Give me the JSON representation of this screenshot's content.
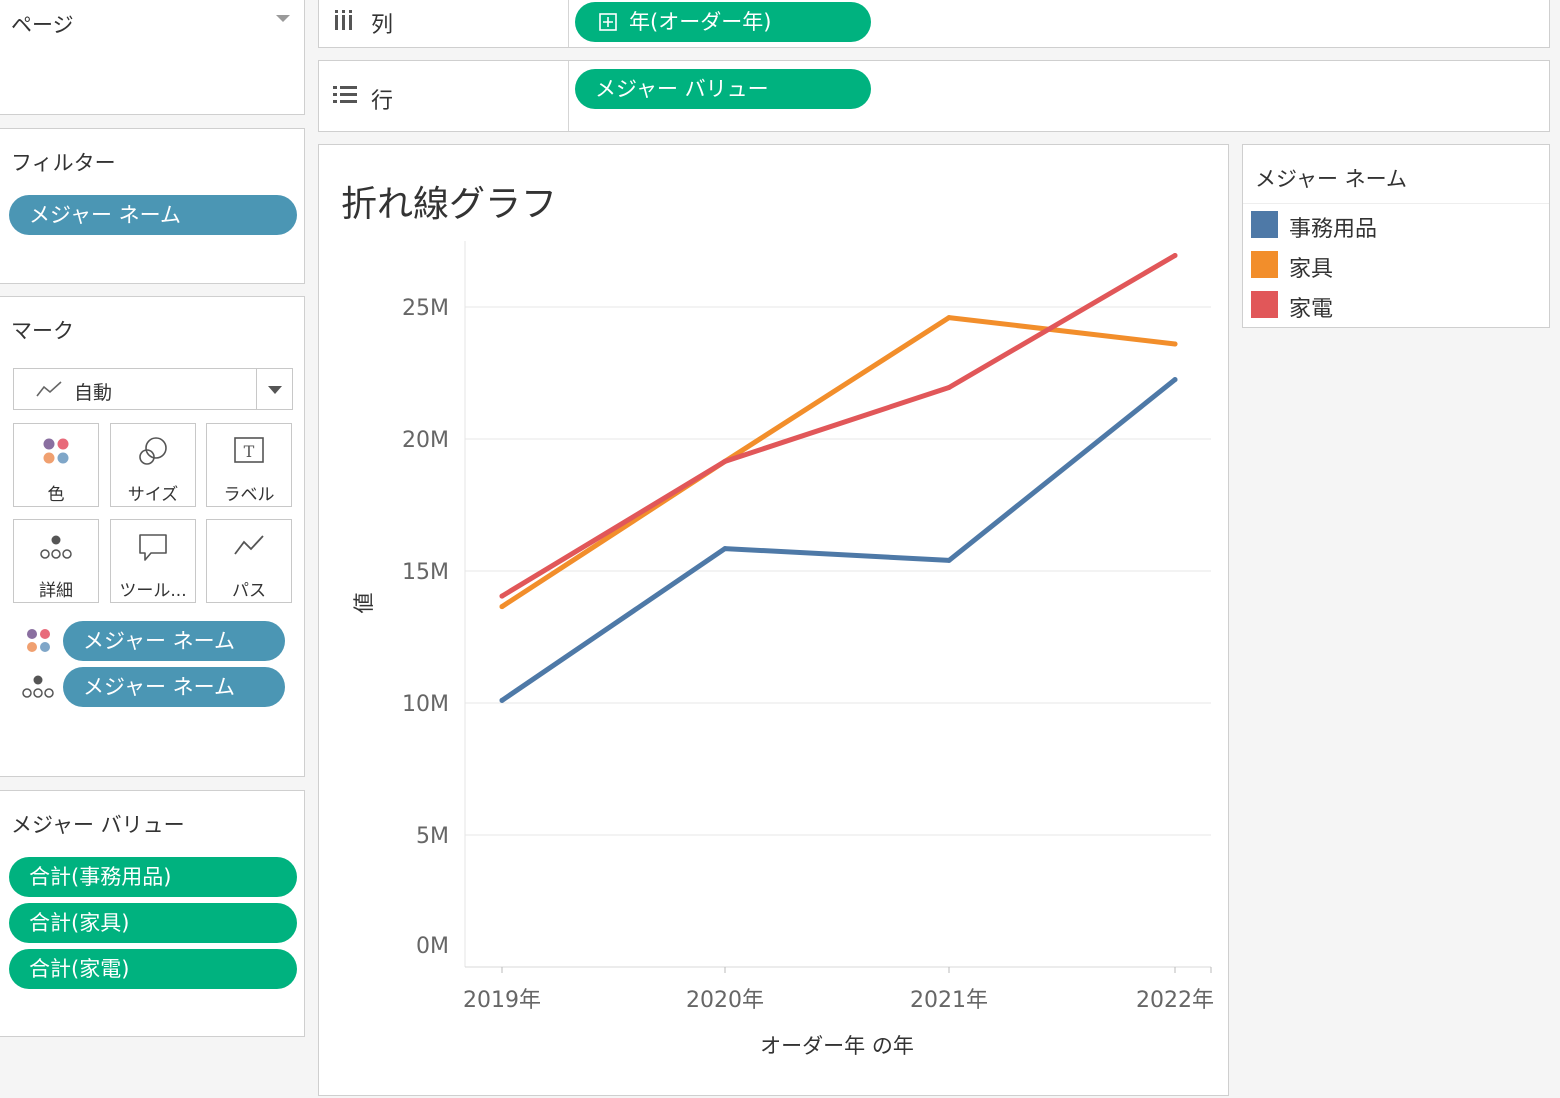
{
  "sidebar": {
    "pages": {
      "title": "ページ"
    },
    "filters": {
      "title": "フィルター",
      "pills": [
        "メジャー ネーム"
      ]
    },
    "marks": {
      "title": "マーク",
      "mark_type": "自動",
      "cards": {
        "color": "色",
        "size": "サイズ",
        "label": "ラベル",
        "detail": "詳細",
        "tooltip": "ツール...",
        "path": "パス"
      },
      "shelf_pills": {
        "color": "メジャー ネーム",
        "detail": "メジャー ネーム"
      }
    },
    "measure_values": {
      "title": "メジャー バリュー",
      "pills": [
        "合計(事務用品)",
        "合計(家具)",
        "合計(家電)"
      ]
    }
  },
  "shelves": {
    "columns": {
      "label": "列",
      "pill": "年(オーダー年)"
    },
    "rows": {
      "label": "行",
      "pill": "メジャー バリュー"
    }
  },
  "legend": {
    "title": "メジャー ネーム",
    "items": [
      {
        "label": "事務用品",
        "color": "#4e79a7"
      },
      {
        "label": "家具",
        "color": "#f28e2b"
      },
      {
        "label": "家電",
        "color": "#e15759"
      }
    ]
  },
  "chart_data": {
    "type": "line",
    "title": "折れ線グラフ",
    "xlabel": "オーダー年 の年",
    "ylabel": "値",
    "categories": [
      "2019年",
      "2020年",
      "2021年",
      "2022年"
    ],
    "ylim": [
      0,
      27500000
    ],
    "yticks": [
      0,
      5000000,
      10000000,
      15000000,
      20000000,
      25000000
    ],
    "ytick_labels": [
      "0M",
      "5M",
      "10M",
      "15M",
      "20M",
      "25M"
    ],
    "grid": true,
    "legend": "right",
    "series": [
      {
        "name": "事務用品",
        "color": "#4e79a7",
        "values": [
          10100000,
          15850000,
          15400000,
          22250000
        ]
      },
      {
        "name": "家具",
        "color": "#f28e2b",
        "values": [
          13650000,
          19150000,
          24600000,
          23600000
        ]
      },
      {
        "name": "家電",
        "color": "#e15759",
        "values": [
          14050000,
          19150000,
          21950000,
          26950000
        ]
      }
    ]
  }
}
